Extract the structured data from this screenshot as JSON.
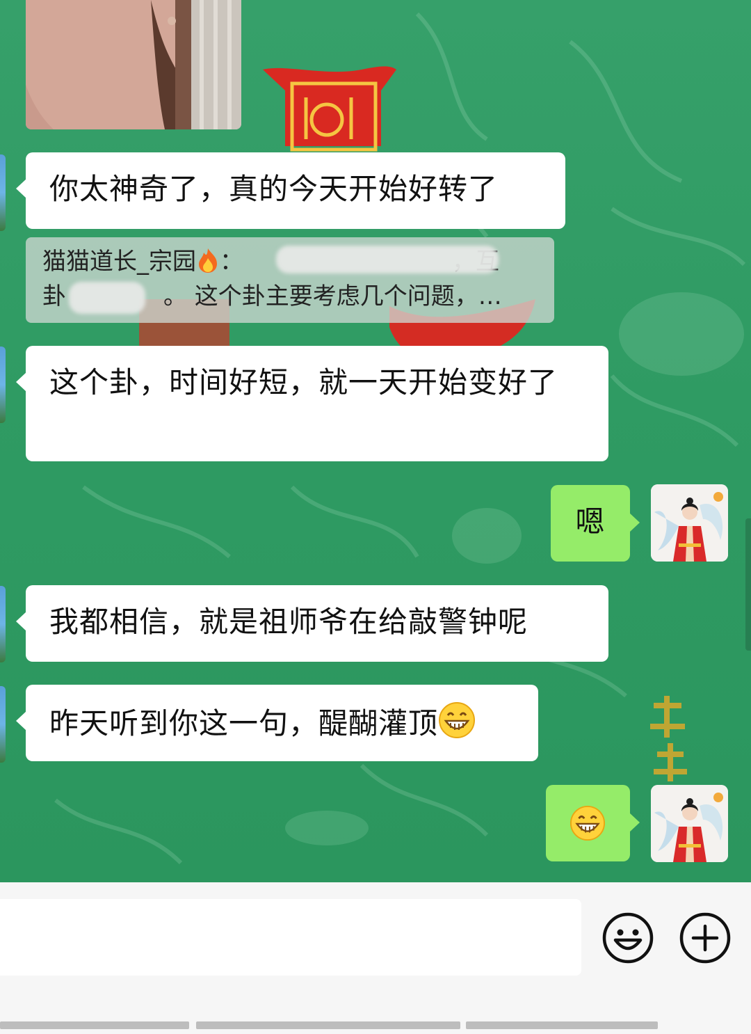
{
  "messages": [
    {
      "id": "m1",
      "side": "left",
      "text": "你太神奇了，真的今天开始好转了"
    },
    {
      "id": "m2",
      "side": "left",
      "text": "这个卦，时间好短，就一天开始变好了"
    },
    {
      "id": "m3",
      "side": "right",
      "text": "嗯"
    },
    {
      "id": "m4",
      "side": "left",
      "text": "我都相信，就是祖师爷在给敲警钟呢"
    },
    {
      "id": "m5",
      "side": "left",
      "text": "昨天听到你这一句，醍醐灌顶",
      "emoji": "grinning-face-emoji"
    },
    {
      "id": "m6",
      "side": "right",
      "emoji": "grinning-face-emoji"
    }
  ],
  "quote": {
    "sender": "猫猫道长_宗园",
    "sender_emoji": "fire-emoji",
    "colon": "：",
    "line1_end": "，互",
    "line2_start": "卦",
    "line2_rest": "。 这个卦主要考虑几个问题，…"
  },
  "input": {
    "value": "",
    "placeholder": ""
  },
  "icons": {
    "emoji_button": "smiley-face-icon",
    "more_button": "plus-circle-icon"
  },
  "colors": {
    "chat_bg": "#30a064",
    "bubble_left": "#ffffff",
    "bubble_right": "#95ec69",
    "input_bar_bg": "#f6f6f6"
  }
}
